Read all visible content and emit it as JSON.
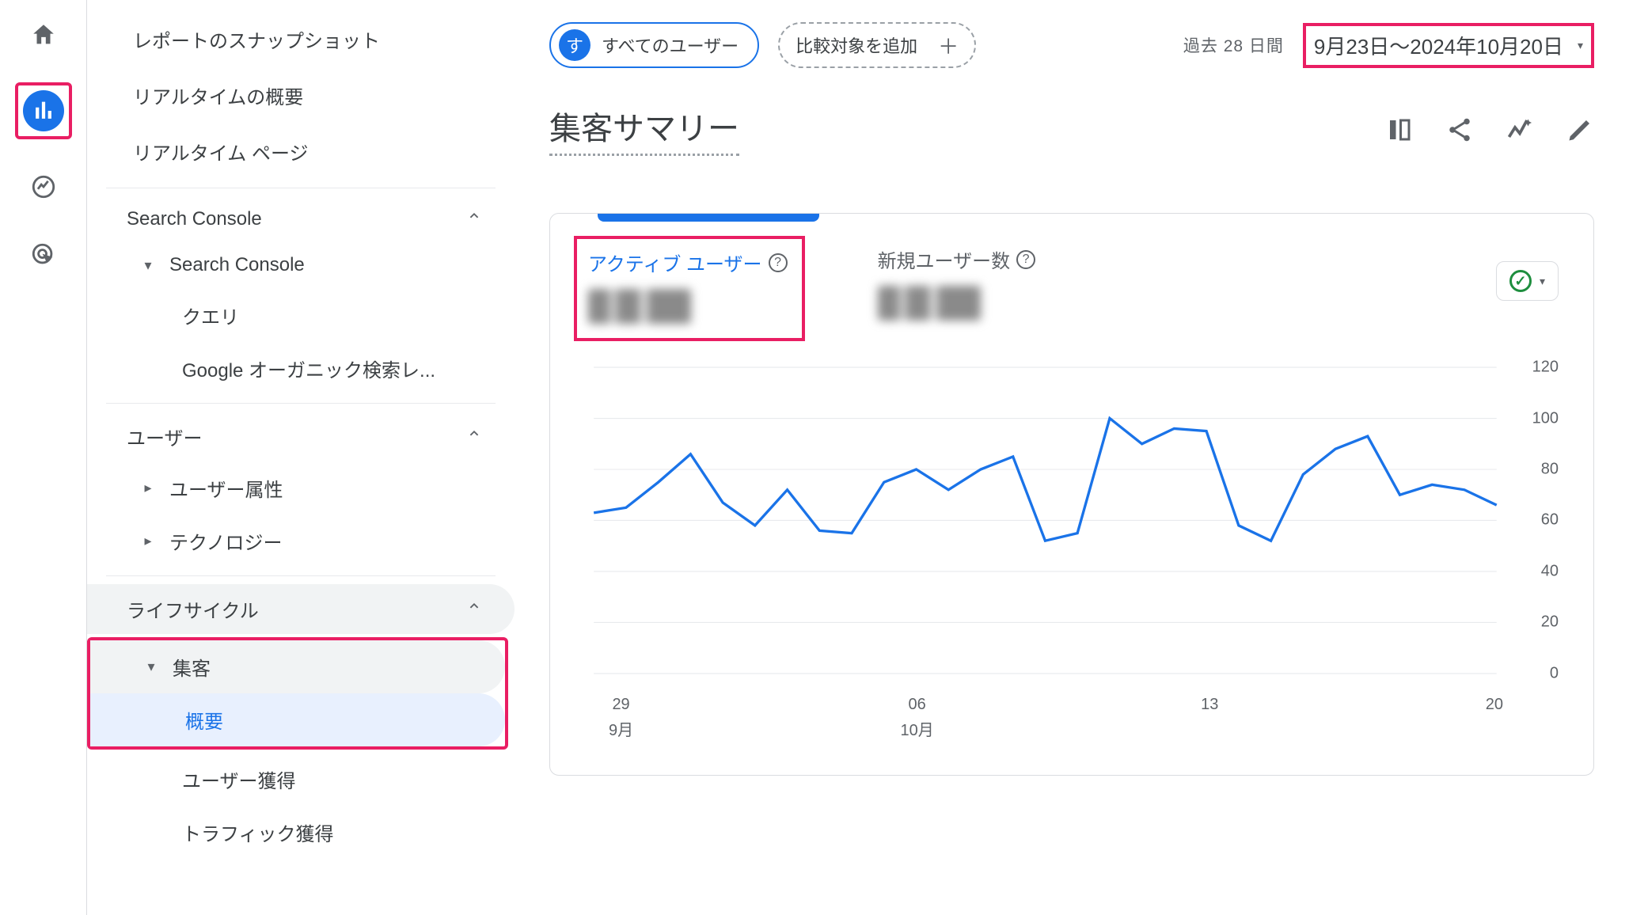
{
  "rail": {
    "home": "home",
    "reports": "reports",
    "explore": "explore",
    "advertising": "advertising"
  },
  "sidebar": {
    "snapshot": "レポートのスナップショット",
    "realtime_overview": "リアルタイムの概要",
    "realtime_pages": "リアルタイム ページ",
    "section_search_console": "Search Console",
    "sub_search_console": "Search Console",
    "leaf_queries": "クエリ",
    "leaf_organic": "Google オーガニック検索レ...",
    "section_user": "ユーザー",
    "sub_user_attributes": "ユーザー属性",
    "sub_technology": "テクノロジー",
    "section_lifecycle": "ライフサイクル",
    "sub_acquisition": "集客",
    "leaf_overview": "概要",
    "leaf_user_acq": "ユーザー獲得",
    "leaf_traffic_acq": "トラフィック獲得"
  },
  "header": {
    "all_users_avatar": "す",
    "all_users": "すべてのユーザー",
    "add_comparison": "比較対象を追加",
    "date_prefix": "過去 28 日間",
    "date_range": "9月23日～2024年10月20日"
  },
  "title": "集客サマリー",
  "metrics": {
    "active_users": "アクティブ ユーザー",
    "new_users": "新規ユーザー数"
  },
  "chart_data": {
    "type": "line",
    "ylim": [
      0,
      120
    ],
    "y_ticks": [
      0,
      20,
      40,
      60,
      80,
      100,
      120
    ],
    "x_ticks": [
      {
        "day": "29",
        "month": "9月"
      },
      {
        "day": "06",
        "month": "10月"
      },
      {
        "day": "13",
        "month": ""
      },
      {
        "day": "20",
        "month": ""
      }
    ],
    "series": [
      {
        "name": "アクティブ ユーザー",
        "color": "#1a73e8",
        "x": [
          0,
          1,
          2,
          3,
          4,
          5,
          6,
          7,
          8,
          9,
          10,
          11,
          12,
          13,
          14,
          15,
          16,
          17,
          18,
          19,
          20,
          21,
          22,
          23,
          24,
          25,
          26,
          27
        ],
        "values": [
          63,
          65,
          75,
          86,
          67,
          58,
          72,
          56,
          55,
          75,
          80,
          72,
          80,
          85,
          52,
          55,
          100,
          90,
          96,
          95,
          58,
          52,
          78,
          88,
          93,
          70,
          74,
          72,
          66
        ]
      }
    ]
  }
}
